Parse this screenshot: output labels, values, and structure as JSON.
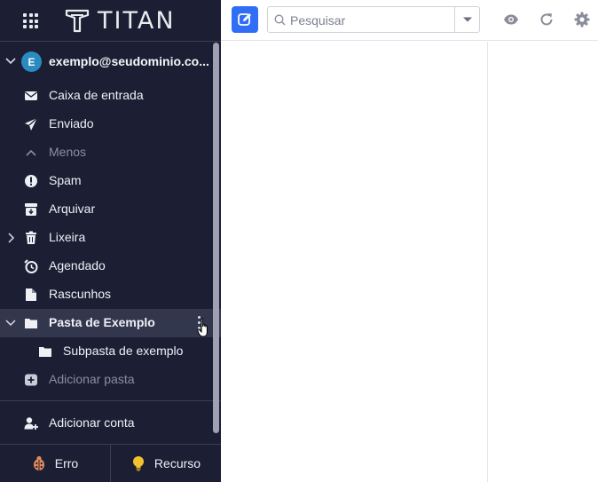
{
  "brand": {
    "name": "TITAN"
  },
  "account": {
    "initial": "E",
    "email": "exemplo@seudominio.co..."
  },
  "folders": [
    {
      "label": "Caixa de entrada",
      "icon": "envelope-icon"
    },
    {
      "label": "Enviado",
      "icon": "paper-plane-icon"
    },
    {
      "label": "Menos",
      "icon": "chevron-up-icon"
    },
    {
      "label": "Spam",
      "icon": "exclamation-circle-icon"
    },
    {
      "label": "Arquivar",
      "icon": "archive-icon"
    },
    {
      "label": "Lixeira",
      "icon": "trash-icon"
    },
    {
      "label": "Agendado",
      "icon": "clock-icon"
    },
    {
      "label": "Rascunhos",
      "icon": "draft-icon"
    },
    {
      "label": "Pasta de Exemplo",
      "icon": "folder-icon"
    },
    {
      "label": "Subpasta de exemplo",
      "icon": "folder-icon"
    },
    {
      "label": "Adicionar pasta",
      "icon": "plus-circle-icon"
    }
  ],
  "add_account": {
    "label": "Adicionar conta"
  },
  "footer": {
    "bug_label": "Erro",
    "feature_label": "Recurso"
  },
  "search": {
    "placeholder": "Pesquisar",
    "value": ""
  },
  "colors": {
    "sidebar_bg": "#1c1f33",
    "accent": "#2f6ef5",
    "active_row": "#33374e",
    "avatar": "#2a8bc0"
  }
}
